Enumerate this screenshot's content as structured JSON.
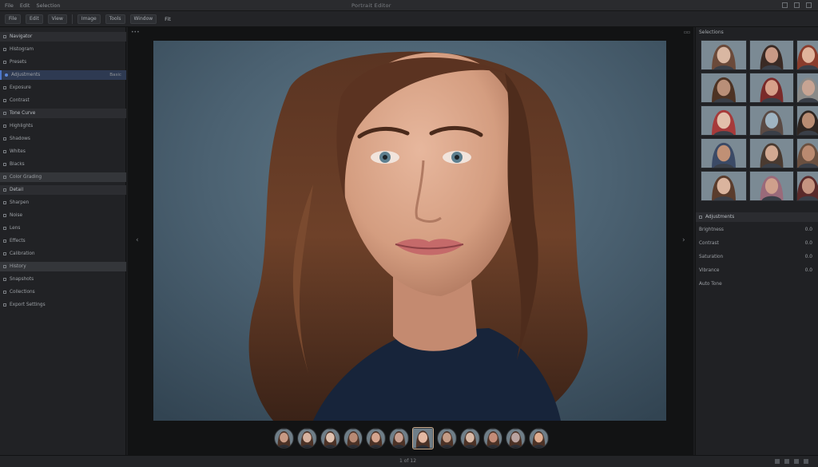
{
  "menubar": {
    "items": [
      "File",
      "Edit",
      "Selection"
    ],
    "window_title": "Portrait Editor"
  },
  "toolbar": {
    "buttons": [
      "File",
      "Edit",
      "View",
      "Image",
      "Tools",
      "Window"
    ],
    "zoom_label": "Fit"
  },
  "left_panel": {
    "rows": [
      {
        "label": "Navigator",
        "value": "",
        "type": "header"
      },
      {
        "label": "Histogram",
        "value": "",
        "type": "row"
      },
      {
        "label": "Presets",
        "value": "",
        "type": "row"
      },
      {
        "label": "Adjustments",
        "value": "Basic",
        "type": "highlight"
      },
      {
        "label": "Exposure",
        "value": "",
        "type": "row"
      },
      {
        "label": "Contrast",
        "value": "",
        "type": "row"
      },
      {
        "label": "Tone Curve",
        "value": "",
        "type": "header"
      },
      {
        "label": "Highlights",
        "value": "",
        "type": "row"
      },
      {
        "label": "Shadows",
        "value": "",
        "type": "row"
      },
      {
        "label": "Whites",
        "value": "",
        "type": "row"
      },
      {
        "label": "Blacks",
        "value": "",
        "type": "row"
      },
      {
        "label": "Color Grading",
        "value": "",
        "type": "selected"
      },
      {
        "label": "Detail",
        "value": "",
        "type": "header"
      },
      {
        "label": "Sharpen",
        "value": "",
        "type": "row"
      },
      {
        "label": "Noise",
        "value": "",
        "type": "row"
      },
      {
        "label": "Lens",
        "value": "",
        "type": "row"
      },
      {
        "label": "Effects",
        "value": "",
        "type": "row"
      },
      {
        "label": "Calibration",
        "value": "",
        "type": "row"
      },
      {
        "label": "History",
        "value": "",
        "type": "selected"
      },
      {
        "label": "Snapshots",
        "value": "",
        "type": "row"
      },
      {
        "label": "Collections",
        "value": "",
        "type": "row"
      },
      {
        "label": "Export Settings",
        "value": "",
        "type": "row"
      }
    ]
  },
  "right_panel": {
    "title": "Selections",
    "grid_count": 15,
    "section_title": "Adjustments",
    "rows": [
      {
        "label": "Brightness",
        "value": "0.0"
      },
      {
        "label": "Contrast",
        "value": "0.0"
      },
      {
        "label": "Saturation",
        "value": "0.0"
      },
      {
        "label": "Vibrance",
        "value": "0.0"
      },
      {
        "label": "Auto Tone",
        "value": ""
      }
    ]
  },
  "filmstrip": {
    "count": 12,
    "selected_index": 6
  },
  "statusbar": {
    "text": "1 of 12"
  },
  "colors": {
    "accent": "#4c76c9",
    "background": "#1b1c1e",
    "panel": "#212225"
  }
}
